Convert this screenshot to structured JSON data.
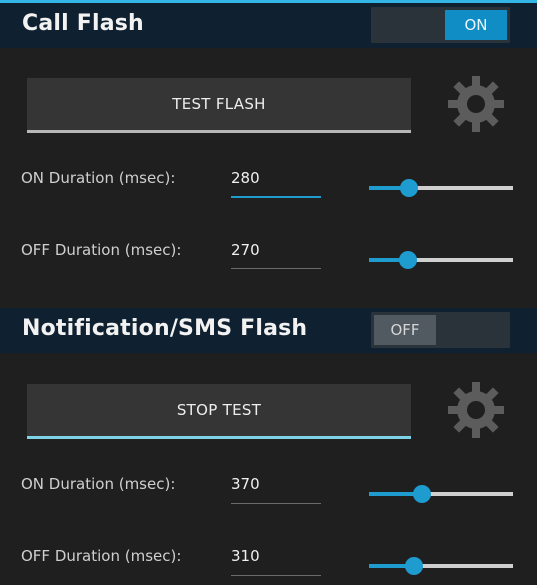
{
  "call_flash": {
    "title": "Call Flash",
    "toggle_label": "ON",
    "toggle_state": "on",
    "test_button_label": "TEST FLASH",
    "on_duration": {
      "label": "ON Duration (msec):",
      "value": "280",
      "slider_fraction": 0.28
    },
    "off_duration": {
      "label": "OFF Duration (msec):",
      "value": "270",
      "slider_fraction": 0.27
    }
  },
  "sms_flash": {
    "title": "Notification/SMS Flash",
    "toggle_label": "OFF",
    "toggle_state": "off",
    "test_button_label": "STOP TEST",
    "on_duration": {
      "label": "ON Duration (msec):",
      "value": "370",
      "slider_fraction": 0.37
    },
    "off_duration": {
      "label": "OFF Duration (msec):",
      "value": "310",
      "slider_fraction": 0.31
    }
  },
  "colors": {
    "accent": "#1e9bcf",
    "header_bg": "#0f2130",
    "background": "#1f1f1f"
  },
  "icons": [
    "gear-icon"
  ]
}
